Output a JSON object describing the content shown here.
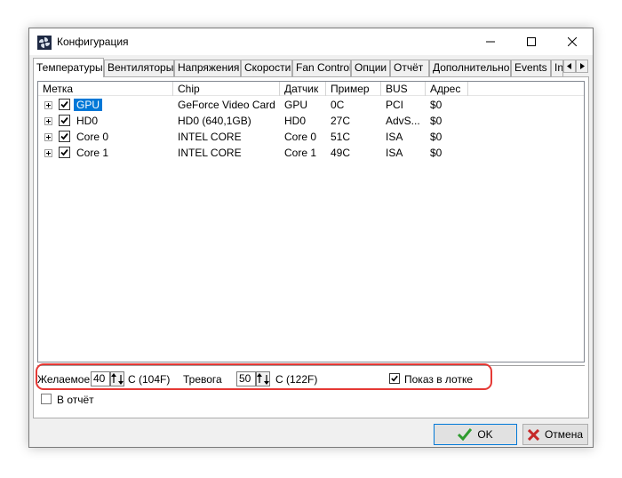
{
  "window": {
    "title": "Конфигурация",
    "icon": "fan-app-icon",
    "controls": {
      "minimize": "minimize-icon",
      "maximize": "maximize-icon",
      "close": "close-icon"
    }
  },
  "tabs": [
    {
      "label": "Температуры",
      "active": true
    },
    {
      "label": "Вентиляторы"
    },
    {
      "label": "Напряжения"
    },
    {
      "label": "Скорости"
    },
    {
      "label": "Fan Control"
    },
    {
      "label": "Опции"
    },
    {
      "label": "Отчёт"
    },
    {
      "label": "Дополнительно"
    },
    {
      "label": "Events"
    },
    {
      "label": "In"
    }
  ],
  "table": {
    "columns": [
      "Метка",
      "Chip",
      "Датчик",
      "Пример",
      "BUS",
      "Адрес"
    ],
    "rows": [
      {
        "label": "GPU",
        "chip": "GeForce Video Card",
        "sensor": "GPU",
        "sample": "0C",
        "bus": "PCI",
        "address": "$0",
        "checked": true,
        "selected": true
      },
      {
        "label": "HD0",
        "chip": "HD0 (640,1GB)",
        "sensor": "HD0",
        "sample": "27C",
        "bus": "AdvS...",
        "address": "$0",
        "checked": true
      },
      {
        "label": "Core 0",
        "chip": "INTEL CORE",
        "sensor": "Core 0",
        "sample": "51C",
        "bus": "ISA",
        "address": "$0",
        "checked": true
      },
      {
        "label": "Core 1",
        "chip": "INTEL CORE",
        "sensor": "Core 1",
        "sample": "49C",
        "bus": "ISA",
        "address": "$0",
        "checked": true
      }
    ]
  },
  "controls": {
    "desired_label": "Желаемое",
    "desired_value": "40",
    "desired_unit": "C (104F)",
    "alarm_label": "Тревога",
    "alarm_value": "50",
    "alarm_unit": "C (122F)",
    "show_in_tray_label": "Показ в лотке",
    "show_in_tray_checked": true,
    "in_report_label": "В отчёт",
    "in_report_checked": false
  },
  "buttons": {
    "ok_label": "OK",
    "cancel_label": "Отмена"
  },
  "colors": {
    "selection": "#0078d7",
    "highlight_ring": "#e53935",
    "ok_check": "#2e9b2e",
    "cancel_x": "#c62828"
  }
}
